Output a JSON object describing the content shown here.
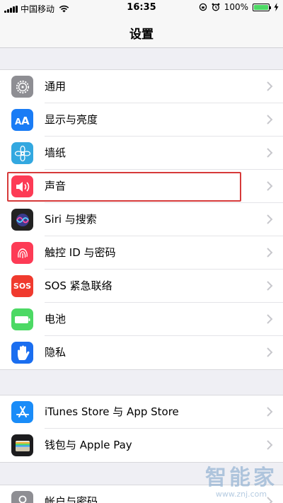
{
  "status_bar": {
    "carrier": "中国移动",
    "time": "16:35",
    "battery_text": "100%",
    "battery_level": 1.0
  },
  "nav": {
    "title": "设置"
  },
  "groups": [
    {
      "items": [
        {
          "label": "通用",
          "icon": "gear-icon",
          "color": "#8e8e93"
        },
        {
          "label": "显示与亮度",
          "icon": "text-size-icon",
          "color": "#1a7cf5"
        },
        {
          "label": "墙纸",
          "icon": "flower-icon",
          "color": "#33a8e0"
        },
        {
          "label": "声音",
          "icon": "speaker-icon",
          "color": "#fd3b55"
        },
        {
          "label": "Siri 与搜索",
          "icon": "siri-icon",
          "color": "#222222"
        },
        {
          "label": "触控 ID 与密码",
          "icon": "fingerprint-icon",
          "color": "#fd3b55"
        },
        {
          "label": "SOS 紧急联络",
          "icon": "sos-icon",
          "color": "#f03a2e",
          "icon_text": "SOS"
        },
        {
          "label": "电池",
          "icon": "battery-icon",
          "color": "#4cd964"
        },
        {
          "label": "隐私",
          "icon": "hand-icon",
          "color": "#1a6ef0"
        }
      ]
    },
    {
      "items": [
        {
          "label": "iTunes Store 与 App Store",
          "icon": "app-store-icon",
          "color": "#1a8cf8"
        },
        {
          "label": "钱包与 Apple Pay",
          "icon": "wallet-icon",
          "color": "#1c1c1e"
        }
      ]
    },
    {
      "items": [
        {
          "label": "帐户与密码",
          "icon": "key-icon",
          "color": "#8e8e93"
        }
      ]
    }
  ],
  "watermark": {
    "big": "智能家",
    "small": "www.znj.com"
  }
}
